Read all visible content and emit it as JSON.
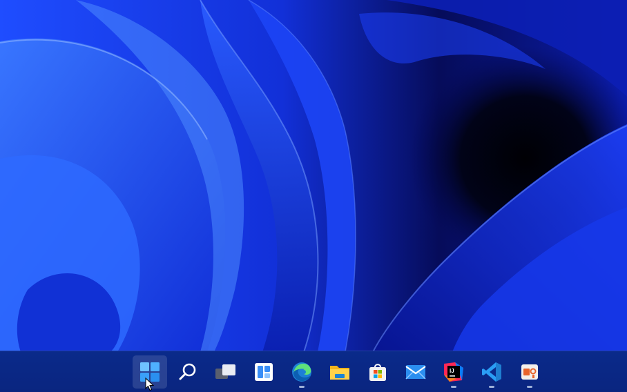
{
  "desktop": {
    "wallpaper_name": "windows-11-bloom-wallpaper",
    "colors": {
      "primary_blue": "#1a3cf0",
      "deep_blue": "#0612a8",
      "dark": "#02030f",
      "taskbar": "#0a2a8a"
    }
  },
  "taskbar": {
    "items": [
      {
        "icon": "windows-start-icon",
        "running": false,
        "active": true
      },
      {
        "icon": "search-icon",
        "running": false
      },
      {
        "icon": "task-view-icon",
        "running": false
      },
      {
        "icon": "widgets-icon",
        "running": false
      },
      {
        "icon": "edge-browser-icon",
        "running": true
      },
      {
        "icon": "file-explorer-icon",
        "running": false
      },
      {
        "icon": "microsoft-store-icon",
        "running": false
      },
      {
        "icon": "mail-icon",
        "running": false
      },
      {
        "icon": "intellij-idea-icon",
        "running": true
      },
      {
        "icon": "vscode-icon",
        "running": true
      },
      {
        "icon": "presentation-app-icon",
        "running": true
      }
    ]
  }
}
